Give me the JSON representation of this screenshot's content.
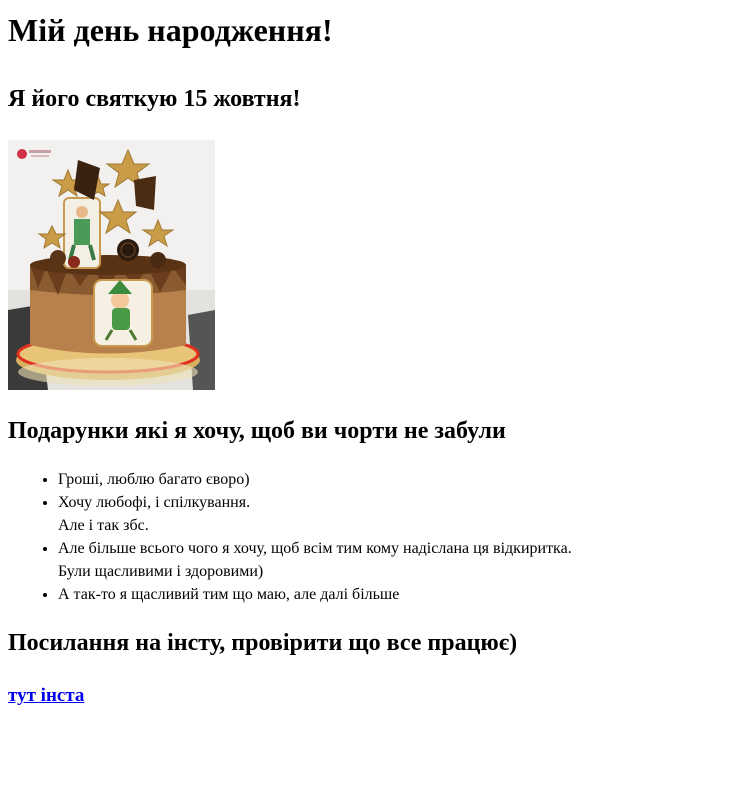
{
  "heading_main": "Мій день народження!",
  "heading_date": "Я його святкую 15 жовтня!",
  "image": {
    "alt": "торт"
  },
  "heading_gifts": "Подарунки які я хочу, щоб ви чорти не забули",
  "gifts": [
    {
      "lines": [
        "Гроші, люблю багато єворо)"
      ]
    },
    {
      "lines": [
        "Хочу любофі, і спілкування.",
        "Але і так збс."
      ]
    },
    {
      "lines": [
        "Але більше всього чого я хочу, щоб всім тим кому надіслана ця відкиритка.",
        "Були щасливими і здоровими)"
      ]
    },
    {
      "lines": [
        "А так-то я щасливий тим що маю, але далі більше"
      ]
    }
  ],
  "heading_insta": "Посилання на інсту, провірити що все працює)",
  "insta_link_text": "тут інста"
}
